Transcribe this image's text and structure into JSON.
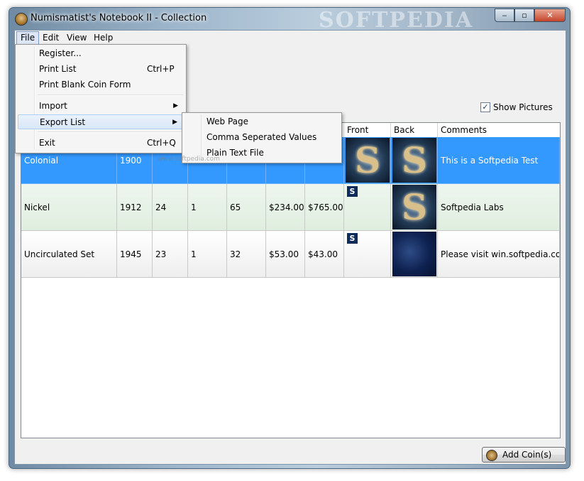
{
  "window": {
    "title": "Numismatist's Notebook II - Collection",
    "watermark": "SOFTPEDIA",
    "minimize": "‒",
    "maximize": "▫",
    "close": "✕"
  },
  "menubar": {
    "file": "File",
    "edit": "Edit",
    "view": "View",
    "help": "Help"
  },
  "file_menu": {
    "register": "Register...",
    "print_list": "Print List",
    "print_list_shortcut": "Ctrl+P",
    "print_blank": "Print Blank Coin Form",
    "import": "Import",
    "export_list": "Export List",
    "exit": "Exit",
    "exit_shortcut": "Ctrl+Q",
    "arrow": "▶"
  },
  "export_submenu": [
    "Web Page",
    "Comma Seperated Values",
    "Plain Text File"
  ],
  "show_pictures": {
    "label": "Show Pictures",
    "checked": true,
    "mark": "✓"
  },
  "grid": {
    "headers": [
      "Front",
      "Back",
      "Comments"
    ],
    "rows": [
      {
        "name": "Colonial",
        "year": "1900",
        "c3": "",
        "c4": "",
        "c5": "",
        "c6": "",
        "c7": "",
        "comments": "This is a Softpedia Test"
      },
      {
        "name": "Nickel",
        "year": "1912",
        "c3": "24",
        "c4": "1",
        "c5": "65",
        "c6": "$234.00",
        "c7": "$765.00",
        "comments": "Softpedia Labs"
      },
      {
        "name": "Uncirculated Set",
        "year": "1945",
        "c3": "23",
        "c4": "1",
        "c5": "32",
        "c6": "$53.00",
        "c7": "$43.00",
        "comments": "Please visit win.softpedia.com"
      }
    ],
    "badge": "S",
    "thumb_letter": "S",
    "small_watermark": "www.softpedia.com"
  },
  "add_button": {
    "label": "Add Coin(s)"
  }
}
